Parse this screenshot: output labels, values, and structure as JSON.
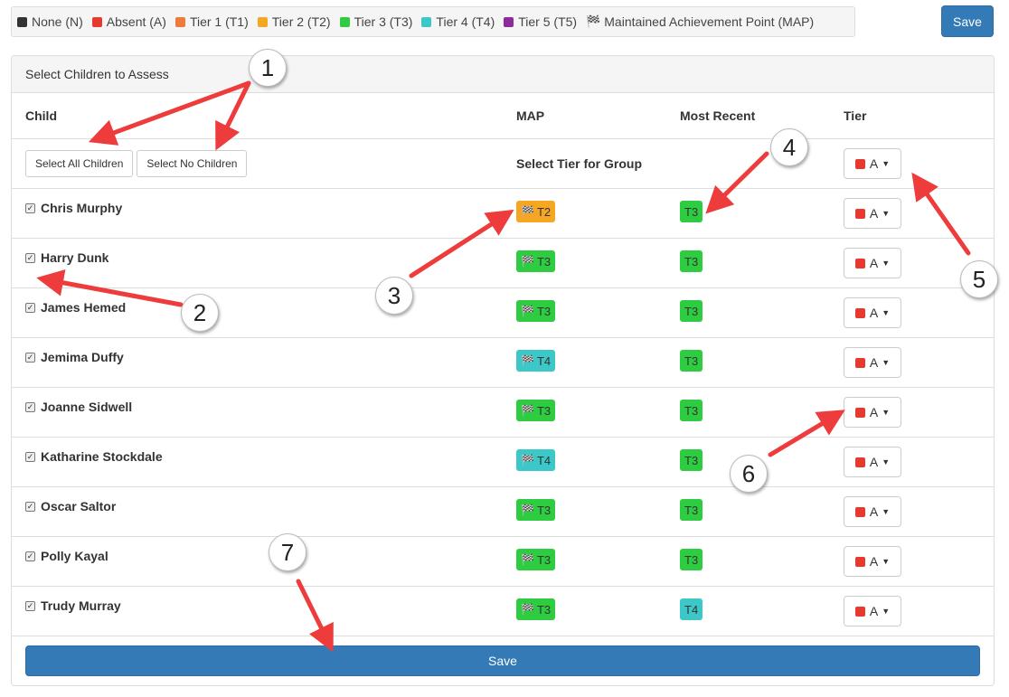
{
  "legend": [
    {
      "label": "None (N)",
      "color": "#333333"
    },
    {
      "label": "Absent (A)",
      "color": "#e8392f"
    },
    {
      "label": "Tier 1 (T1)",
      "color": "#f07a3a"
    },
    {
      "label": "Tier 2 (T2)",
      "color": "#f5a623"
    },
    {
      "label": "Tier 3 (T3)",
      "color": "#2ecc40"
    },
    {
      "label": "Tier 4 (T4)",
      "color": "#3cc8c8"
    },
    {
      "label": "Tier 5 (T5)",
      "color": "#8e2a9b"
    },
    {
      "label": "Maintained Achievement Point (MAP)",
      "icon": "flag-icon"
    }
  ],
  "toolbar": {
    "save_label": "Save"
  },
  "panel": {
    "title": "Select Children to Assess",
    "columns": {
      "child": "Child",
      "map": "MAP",
      "recent": "Most Recent",
      "tier": "Tier"
    },
    "select_all_label": "Select All Children",
    "select_none_label": "Select No Children",
    "group_label": "Select Tier for Group",
    "group_tier": "A",
    "children": [
      {
        "name": "Chris Murphy",
        "map": "T2",
        "recent": "T3",
        "tier": "A"
      },
      {
        "name": "Harry Dunk",
        "map": "T3",
        "recent": "T3",
        "tier": "A"
      },
      {
        "name": "James Hemed",
        "map": "T3",
        "recent": "T3",
        "tier": "A"
      },
      {
        "name": "Jemima Duffy",
        "map": "T4",
        "recent": "T3",
        "tier": "A"
      },
      {
        "name": "Joanne Sidwell",
        "map": "T3",
        "recent": "T3",
        "tier": "A"
      },
      {
        "name": "Katharine Stockdale",
        "map": "T4",
        "recent": "T3",
        "tier": "A"
      },
      {
        "name": "Oscar Saltor",
        "map": "T3",
        "recent": "T3",
        "tier": "A"
      },
      {
        "name": "Polly Kayal",
        "map": "T3",
        "recent": "T3",
        "tier": "A"
      },
      {
        "name": "Trudy Murray",
        "map": "T3",
        "recent": "T4",
        "tier": "A"
      }
    ],
    "save_label": "Save"
  },
  "tier_colors": {
    "T2": "#f5a623",
    "T3": "#2ecc40",
    "T4": "#3cc8c8",
    "A": "#e8392f"
  },
  "callouts": [
    "1",
    "2",
    "3",
    "4",
    "5",
    "6",
    "7"
  ]
}
